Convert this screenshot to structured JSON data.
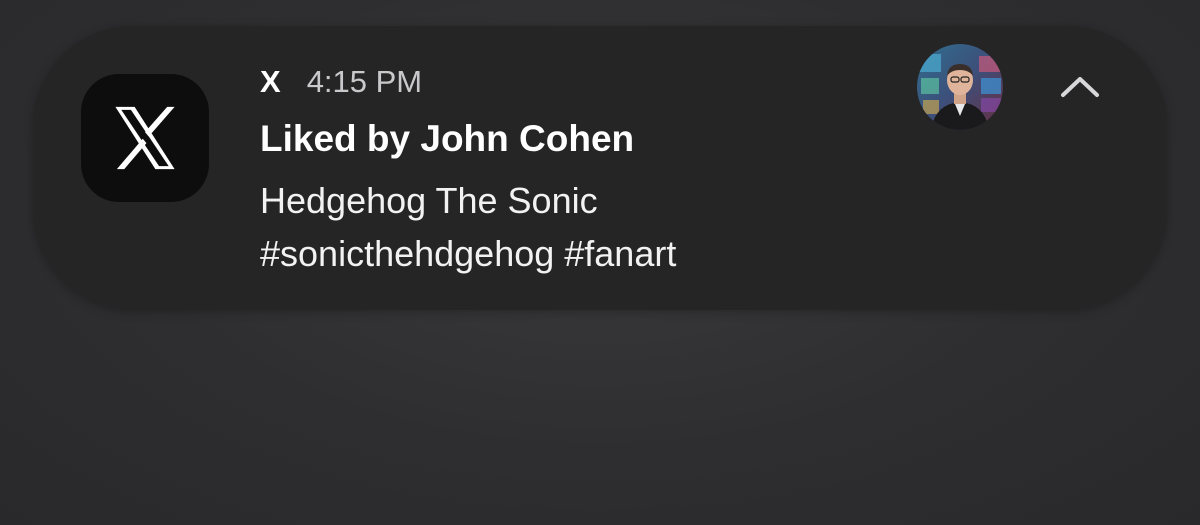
{
  "notification": {
    "app_name": "X",
    "time": "4:15 PM",
    "title": "Liked by John Cohen",
    "body_lines": [
      "Hedgehog The Sonic",
      "#sonicthehdgehog #fanart"
    ],
    "app_icon": "x-logo-icon",
    "avatar": "user-avatar",
    "expand_icon": "chevron-up-icon"
  },
  "colors": {
    "background": "#2e2e30",
    "card": "#252526",
    "icon_bg": "#0d0d0e",
    "text_primary": "#ffffff",
    "text_secondary": "#c9c9cb"
  }
}
